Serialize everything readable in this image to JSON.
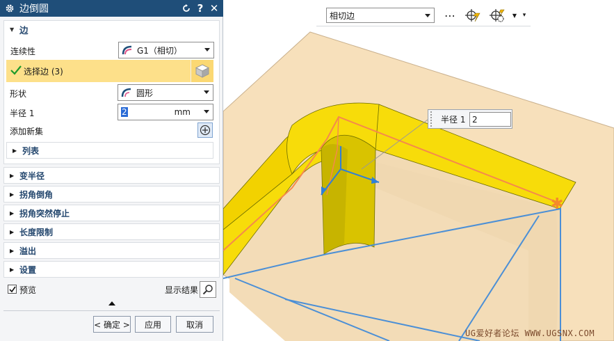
{
  "dialog": {
    "title": "边倒圆",
    "edge_group": {
      "label": "边",
      "continuity_label": "连续性",
      "continuity_value": "G1（相切）",
      "select_edge_label": "选择边 (3)",
      "shape_label": "形状",
      "shape_value": "圆形",
      "radius_label": "半径 1",
      "radius_value": "2",
      "radius_unit": "mm",
      "add_set_label": "添加新集",
      "list_label": "列表"
    },
    "collapsed_groups": [
      "变半径",
      "拐角倒角",
      "拐角突然停止",
      "长度限制",
      "溢出",
      "设置"
    ],
    "preview_label": "预览",
    "show_result_label": "显示结果",
    "buttons": {
      "ok": "< 确定 >",
      "apply": "应用",
      "cancel": "取消"
    }
  },
  "toolbar": {
    "filter_value": "相切边",
    "more": "⋯"
  },
  "dynamic_label": {
    "label": "半径 1",
    "value": "2"
  },
  "watermark": "UG爱好者论坛 WWW.UGSNX.COM",
  "colors": {
    "titlebar": "#1f4e79",
    "selection_highlight": "#fde08a",
    "fillet_yellow": "#f7dc0a",
    "plate": "#f7e0bb",
    "edge_orange": "#f5894c",
    "dimension_blue": "#4b8fd6"
  }
}
